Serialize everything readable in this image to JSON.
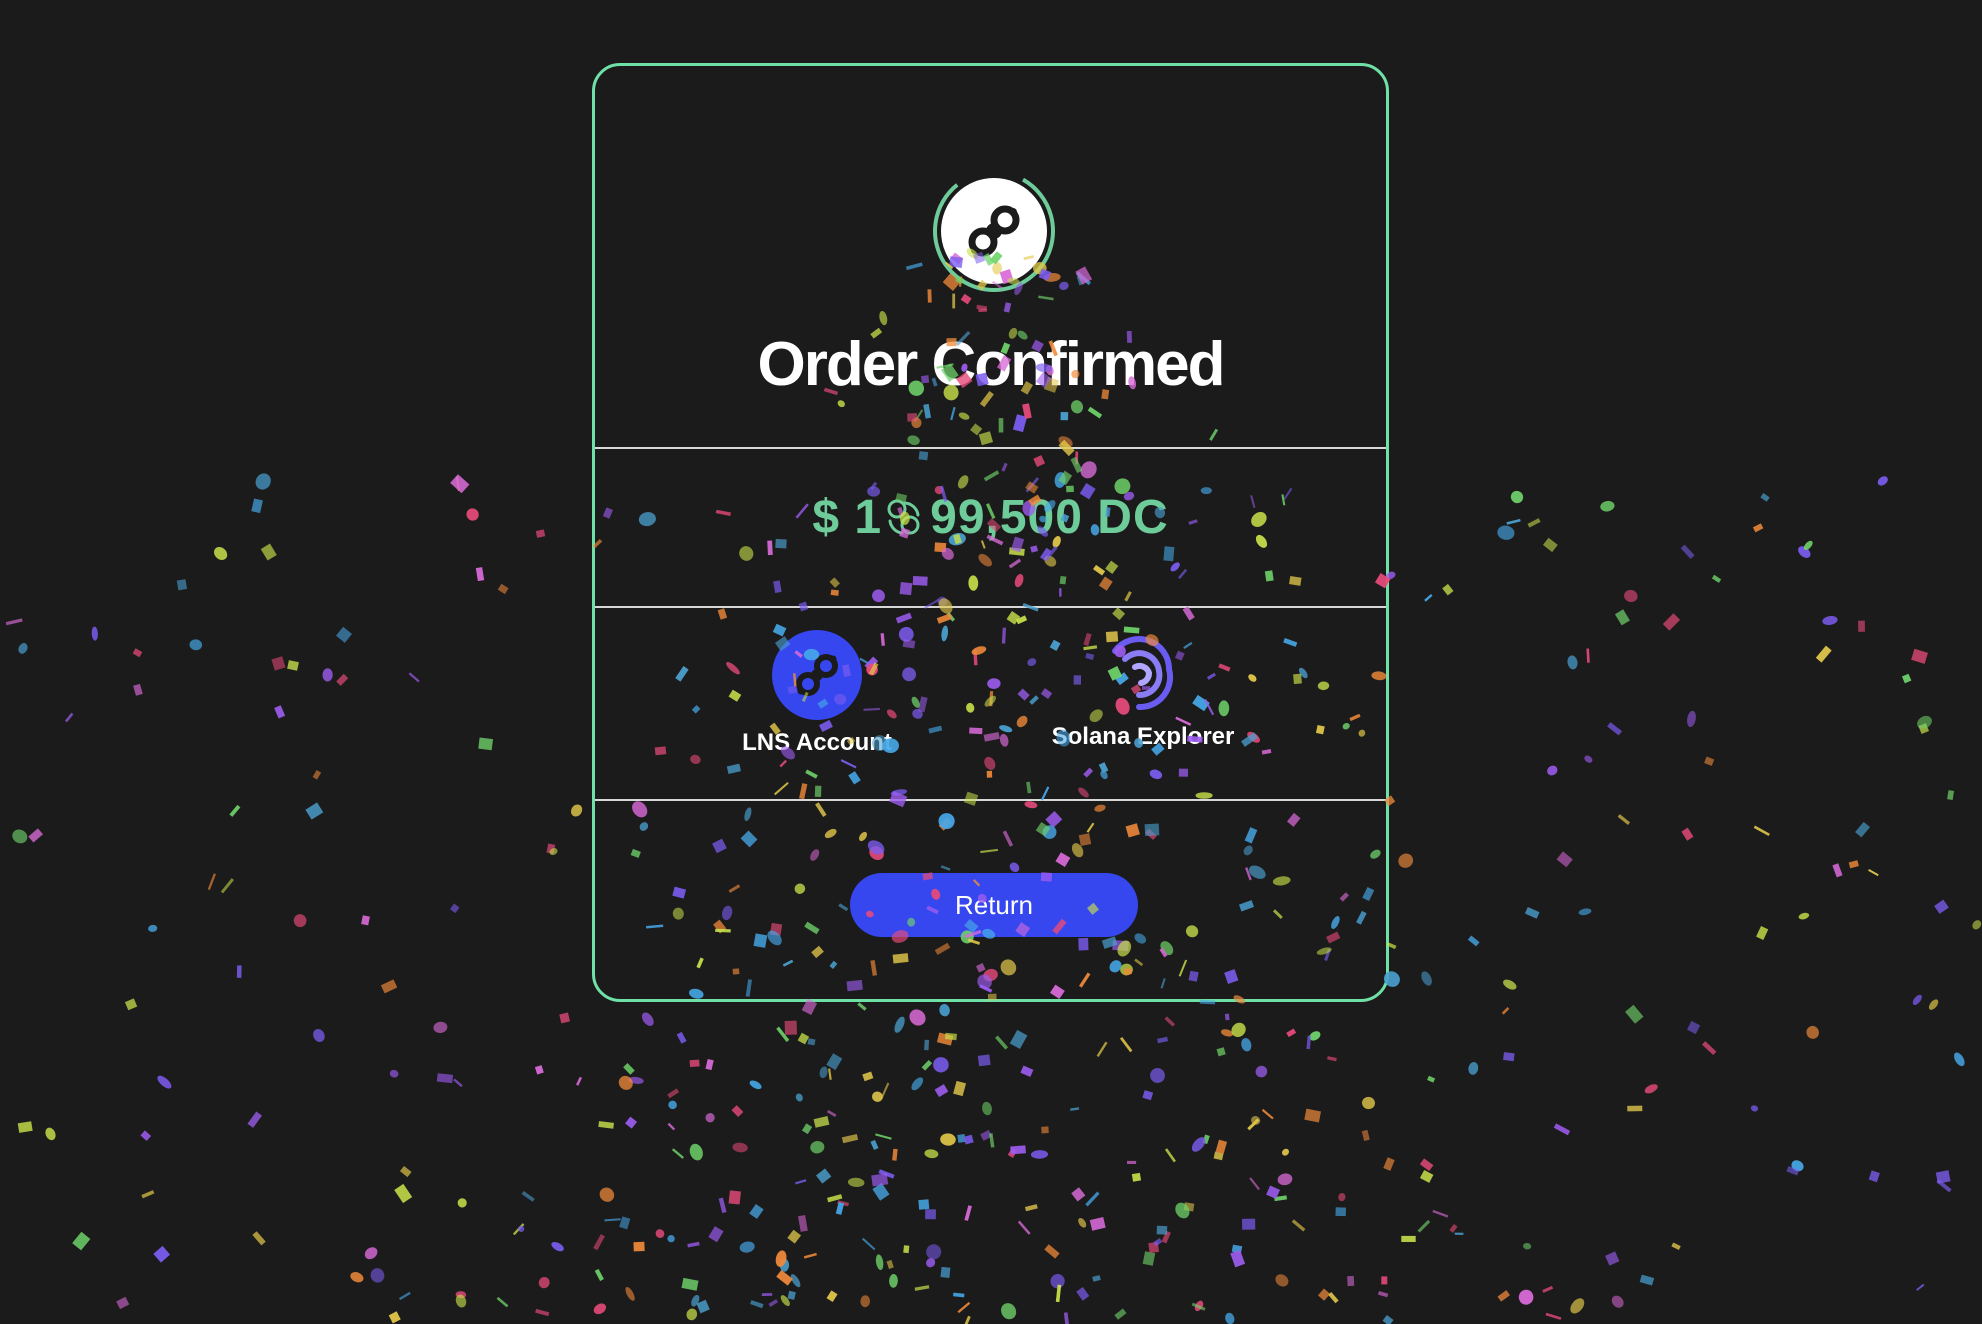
{
  "card": {
    "title": "Order Confirmed",
    "amount_prefix": "$ 1",
    "amount_suffix": "99,500 DC",
    "border_color": "#6fe0a6",
    "amount_color": "#6ecb9a"
  },
  "links": {
    "lns_label": "LNS Account",
    "explorer_label": "Solana Explorer",
    "lns_icon": "helium-link-icon",
    "explorer_icon": "solana-explorer-icon"
  },
  "actions": {
    "return_label": "Return",
    "return_color": "#3647f0"
  },
  "icons": {
    "top_logo": "helium-logo-icon",
    "amount_spinner": "loading-spinner-icon"
  },
  "confetti_colors": [
    "#7b5cf0",
    "#d86ad8",
    "#e2c84a",
    "#6fd36a",
    "#46a8e8",
    "#f08a3a",
    "#e64a7a",
    "#4aa0d0",
    "#9c5cf0",
    "#c8e04a"
  ]
}
